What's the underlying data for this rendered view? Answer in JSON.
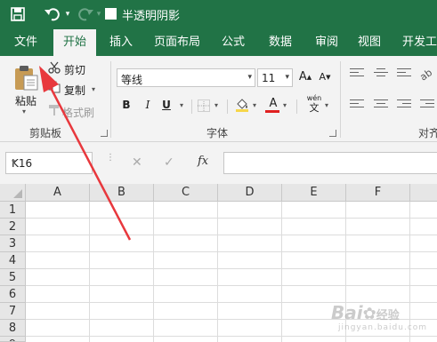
{
  "title_bar": {
    "document_title": "半透明阴影",
    "icons": [
      "save-icon",
      "undo-icon",
      "redo-icon",
      "checkbox-icon"
    ],
    "background": "#217346"
  },
  "tabs": [
    {
      "label": "文件",
      "active": false
    },
    {
      "label": "开始",
      "active": true
    },
    {
      "label": "插入",
      "active": false
    },
    {
      "label": "页面布局",
      "active": false
    },
    {
      "label": "公式",
      "active": false
    },
    {
      "label": "数据",
      "active": false
    },
    {
      "label": "审阅",
      "active": false
    },
    {
      "label": "视图",
      "active": false
    },
    {
      "label": "开发工",
      "active": false
    }
  ],
  "clipboard": {
    "paste_label": "粘贴",
    "cut_label": "剪切",
    "copy_label": "复制",
    "format_painter_label": "格式刷",
    "group_label": "剪贴板"
  },
  "font": {
    "font_name": "等线",
    "font_size": "11",
    "bold": "B",
    "italic": "I",
    "underline": "U",
    "grow": "A",
    "shrink": "A",
    "font_color_letter": "A",
    "phonetic_top": "wén",
    "phonetic_bottom": "文",
    "group_label": "字体",
    "font_color": "#e02020"
  },
  "alignment": {
    "group_label": "对齐"
  },
  "formula_bar": {
    "name_box": "K16",
    "cancel": "✕",
    "enter": "✓",
    "fx": "fx",
    "formula": ""
  },
  "columns": [
    "A",
    "B",
    "C",
    "D",
    "E",
    "F"
  ],
  "rows": [
    "1",
    "2",
    "3",
    "4",
    "5",
    "6",
    "7",
    "8",
    "9"
  ],
  "annotation": {
    "color": "#e8383d"
  },
  "watermark": {
    "brand": "Bai",
    "brand2": "经验",
    "url": "jingyan.baidu.com"
  }
}
